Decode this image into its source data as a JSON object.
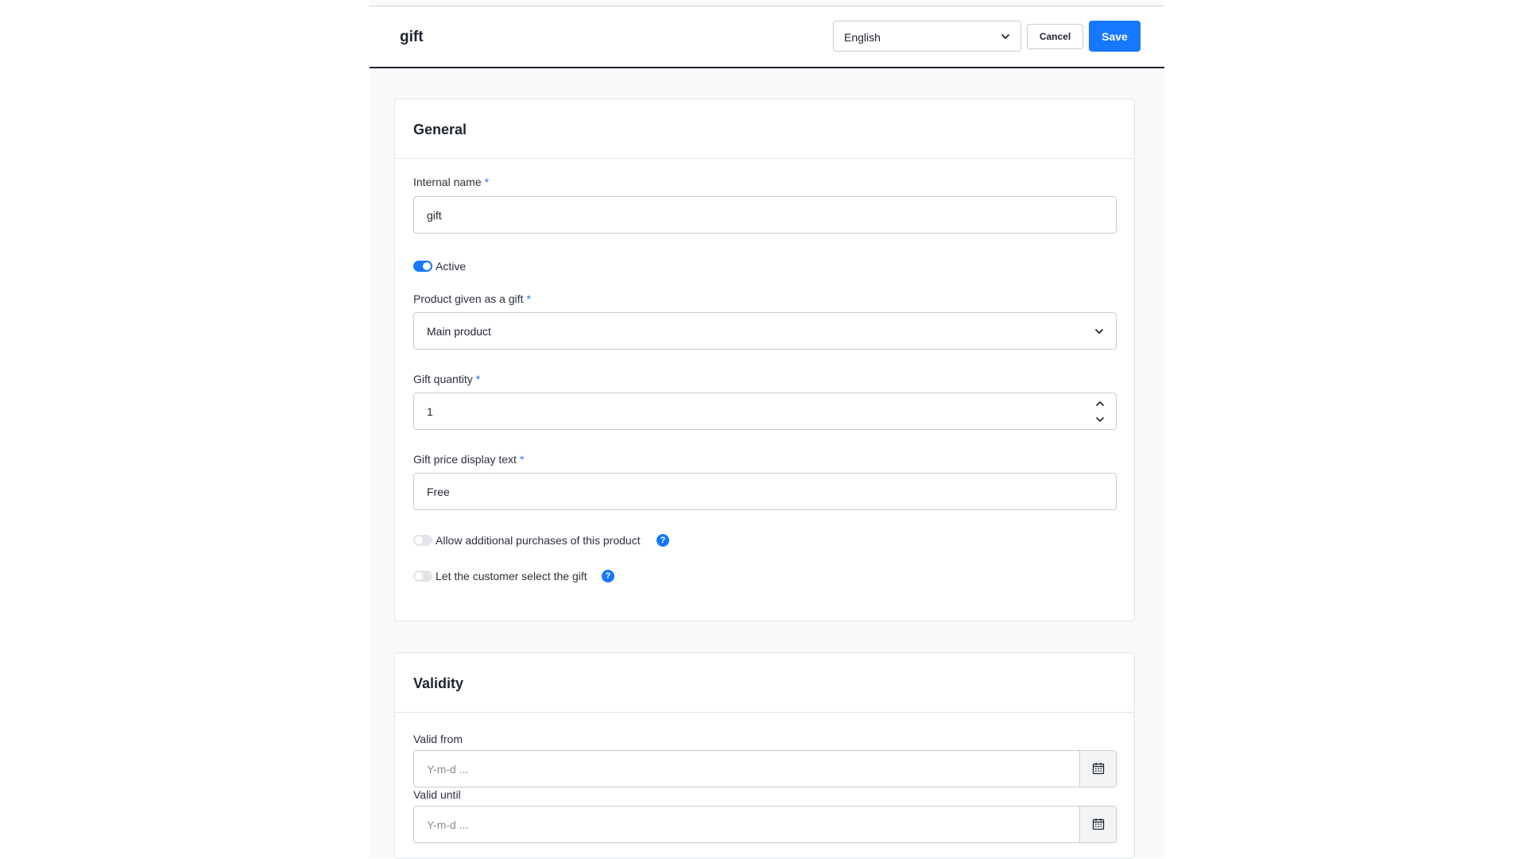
{
  "header": {
    "title": "gift",
    "language": "English",
    "cancel_label": "Cancel",
    "save_label": "Save"
  },
  "general": {
    "title": "General",
    "internal_name": {
      "label": "Internal name",
      "required": "*",
      "value": "gift"
    },
    "active": {
      "label": "Active",
      "enabled": true
    },
    "product": {
      "label": "Product given as a gift",
      "required": "*",
      "value": "Main product"
    },
    "quantity": {
      "label": "Gift quantity",
      "required": "*",
      "value": "1"
    },
    "price_text": {
      "label": "Gift price display text",
      "required": "*",
      "value": "Free"
    },
    "allow_additional": {
      "label": "Allow additional purchases of this product",
      "enabled": false,
      "help": "?"
    },
    "customer_select": {
      "label": "Let the customer select the gift",
      "enabled": false,
      "help": "?"
    }
  },
  "validity": {
    "title": "Validity",
    "valid_from": {
      "label": "Valid from",
      "placeholder": "Y-m-d ..."
    },
    "valid_until": {
      "label": "Valid until",
      "placeholder": "Y-m-d ..."
    }
  },
  "colors": {
    "accent": "#1677ff",
    "text": "#1f2430",
    "border": "#c7cbd1",
    "background": "#f8fafc"
  },
  "icons": {
    "language_dropdown": "chevron-down-icon",
    "product_dropdown": "chevron-down-icon",
    "stepper_up": "chevron-up-icon",
    "stepper_down": "chevron-down-icon",
    "date_picker": "calendar-icon",
    "help": "question-icon"
  }
}
